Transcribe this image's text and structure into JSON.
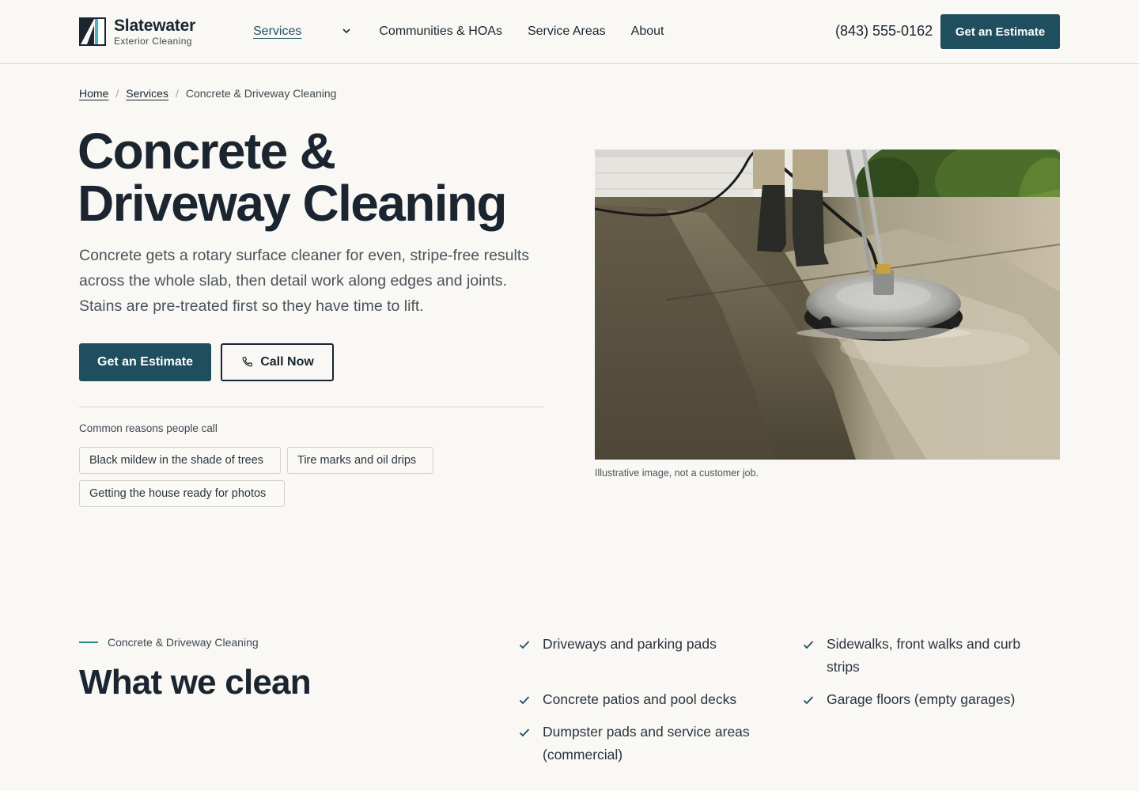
{
  "brand": {
    "name": "Slatewater",
    "tagline": "Exterior Cleaning"
  },
  "nav": {
    "items": [
      "Services",
      "Communities & HOAs",
      "Service Areas",
      "About"
    ],
    "active": "Services"
  },
  "header": {
    "phone": "(843) 555-0162",
    "cta_label": "Get an Estimate"
  },
  "breadcrumb": {
    "home": "Home",
    "services": "Services",
    "current": "Concrete & Driveway Cleaning",
    "separator": "/"
  },
  "hero": {
    "title_line1": "Concrete &",
    "title_line2": "Driveway Cleaning",
    "body": "Concrete gets a rotary surface cleaner for even, stripe-free results across the whole slab, then detail work along edges and joints. Stains are pre-treated first so they have time to lift.",
    "primary_cta": "Get an Estimate",
    "secondary_cta": "Call Now",
    "secondary_icon": "phone-icon",
    "reasons_label": "Common reasons people call",
    "reasons": [
      "Black mildew in the shade of trees",
      "Tire marks and oil drips",
      "Getting the house ready for photos"
    ],
    "image_caption": "Illustrative image, not a customer job."
  },
  "what_we_clean": {
    "eyebrow": "Concrete & Driveway Cleaning",
    "title": "What we clean",
    "items": [
      "Driveways and parking pads",
      "Sidewalks, front walks and curb strips",
      "Concrete patios and pool decks",
      "Garage floors (empty garages)",
      "Dumpster pads and service areas (commercial)"
    ]
  },
  "colors": {
    "background": "#f9f8f5",
    "primary": "#1f4e5f",
    "text": "#1a2530",
    "accent_teal": "#2b8a8a"
  }
}
